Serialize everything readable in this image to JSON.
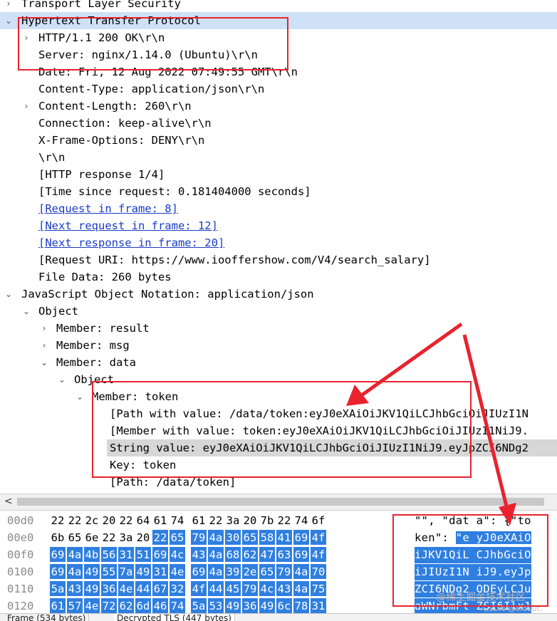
{
  "colors": {
    "selection_row": "#cfe1f7",
    "highlight_row": "#d7d7d7",
    "hex_selection": "#2f7fe0",
    "link": "#1a3cc4",
    "annotation": "#e8232e"
  },
  "tree": [
    {
      "label": "Transport Layer Security",
      "toggle": "chevron-right-icon",
      "glyph": "›"
    },
    {
      "label": "Hypertext Transfer Protocol",
      "toggle": "chevron-down-icon",
      "glyph": "⌄"
    },
    {
      "label": "HTTP/1.1 200 OK\\r\\n",
      "toggle": "chevron-right-icon",
      "glyph": "›"
    },
    {
      "label": "Server: nginx/1.14.0 (Ubuntu)\\r\\n"
    },
    {
      "label": "Date: Fri, 12 Aug 2022 07:49:55 GMT\\r\\n"
    },
    {
      "label": "Content-Type: application/json\\r\\n"
    },
    {
      "label": "Content-Length: 260\\r\\n",
      "toggle": "chevron-right-icon",
      "glyph": "›"
    },
    {
      "label": "Connection: keep-alive\\r\\n"
    },
    {
      "label": "X-Frame-Options: DENY\\r\\n"
    },
    {
      "label": "\\r\\n"
    },
    {
      "label": "[HTTP response 1/4]"
    },
    {
      "label": "[Time since request: 0.181404000 seconds]"
    },
    {
      "label": "[Request in frame: 8]"
    },
    {
      "label": "[Next request in frame: 12]"
    },
    {
      "label": "[Next response in frame: 20]"
    },
    {
      "label": "[Request URI: https://www.iooffershow.com/V4/search_salary]"
    },
    {
      "label": "File Data: 260 bytes"
    },
    {
      "label": "JavaScript Object Notation: application/json",
      "toggle": "chevron-down-icon",
      "glyph": "⌄"
    },
    {
      "label": "Object",
      "toggle": "chevron-down-icon",
      "glyph": "⌄"
    },
    {
      "label": "Member: result",
      "toggle": "chevron-right-icon",
      "glyph": "›"
    },
    {
      "label": "Member: msg",
      "toggle": "chevron-right-icon",
      "glyph": "›"
    },
    {
      "label": "Member: data",
      "toggle": "chevron-down-icon",
      "glyph": "⌄"
    },
    {
      "label": "Object",
      "toggle": "chevron-down-icon",
      "glyph": "⌄"
    },
    {
      "label": "Member: token",
      "toggle": "chevron-down-icon",
      "glyph": "⌄"
    },
    {
      "label": "[Path with value: /data/token:eyJ0eXAiOiJKV1QiLCJhbGciOiJIUzI1N"
    },
    {
      "label": "[Member with value: token:eyJ0eXAiOiJKV1QiLCJhbGciOiJIUzI1NiJ9."
    },
    {
      "label": "String value: eyJ0eXAiOiJKV1QiLCJhbGciOiJIUzI1NiJ9.eyJpZCI6NDg2"
    },
    {
      "label": "Key: token"
    },
    {
      "label": "[Path: /data/token]"
    }
  ],
  "scrollbar": {
    "left_arrow": "<"
  },
  "hex_rows": [
    {
      "offset": "00d0",
      "bytes": [
        "22",
        "22",
        "2c",
        "20",
        "22",
        "64",
        "61",
        "74",
        "61",
        "22",
        "3a",
        "20",
        "7b",
        "22",
        "74",
        "6f"
      ],
      "ascii": "\"\", \"dat a\": {\"to"
    },
    {
      "offset": "00e0",
      "bytes": [
        "6b",
        "65",
        "6e",
        "22",
        "3a",
        "20",
        "22",
        "65",
        "79",
        "4a",
        "30",
        "65",
        "58",
        "41",
        "69",
        "4f"
      ],
      "ascii": "ken\": \"e yJ0eXAiO"
    },
    {
      "offset": "00f0",
      "bytes": [
        "69",
        "4a",
        "4b",
        "56",
        "31",
        "51",
        "69",
        "4c",
        "43",
        "4a",
        "68",
        "62",
        "47",
        "63",
        "69",
        "4f"
      ],
      "ascii": "iJKV1QiL CJhbGciO"
    },
    {
      "offset": "0100",
      "bytes": [
        "69",
        "4a",
        "49",
        "55",
        "7a",
        "49",
        "31",
        "4e",
        "69",
        "4a",
        "39",
        "2e",
        "65",
        "79",
        "4a",
        "70"
      ],
      "ascii": "iJIUzI1N iJ9.eyJp"
    },
    {
      "offset": "0110",
      "bytes": [
        "5a",
        "43",
        "49",
        "36",
        "4e",
        "44",
        "67",
        "32",
        "4f",
        "44",
        "45",
        "79",
        "4c",
        "43",
        "4a",
        "75"
      ],
      "ascii": "ZCI6NDg2 ODEyLCJu"
    },
    {
      "offset": "0120",
      "bytes": [
        "61",
        "57",
        "4e",
        "72",
        "62",
        "6d",
        "46",
        "74",
        "5a",
        "53",
        "49",
        "36",
        "49",
        "6c",
        "78",
        "31"
      ],
      "ascii": "aWNrbmFt ZSI6Ilx1"
    }
  ],
  "bottom_tabs": [
    "Frame (534 bytes)",
    "Decrypted TLS (447 bytes)"
  ],
  "watermark": "@稀土掘金技术社区",
  "csdn_mark": "CSDN @sid10t."
}
